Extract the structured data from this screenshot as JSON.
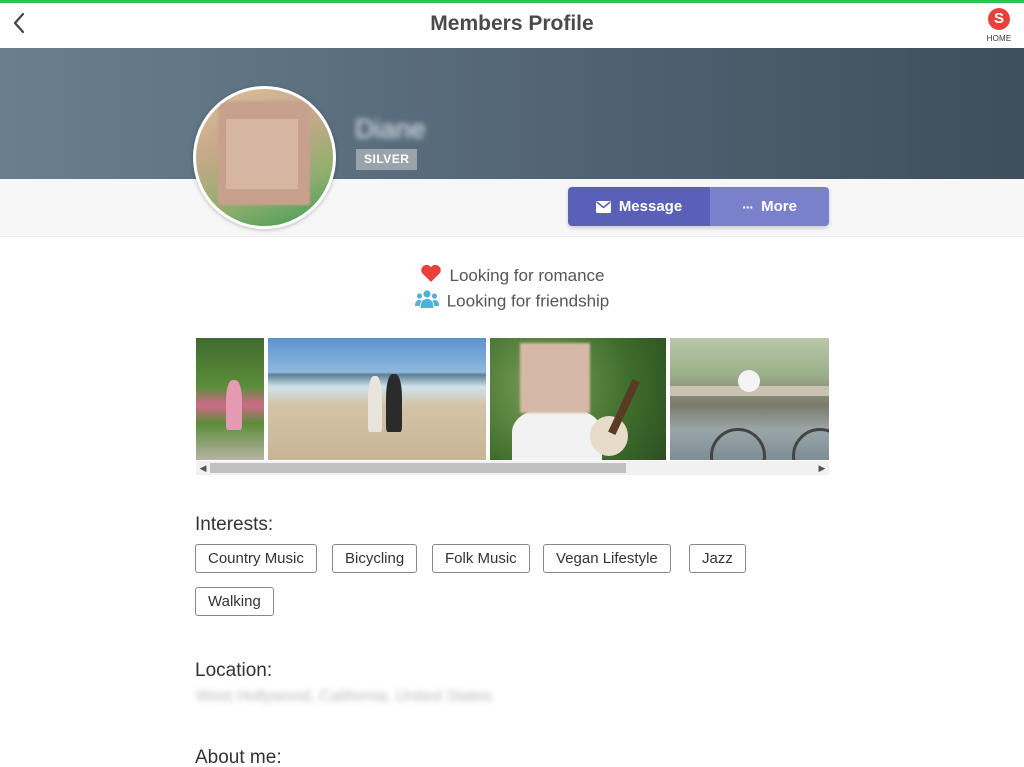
{
  "header": {
    "title": "Members Profile",
    "home_label": "HOME",
    "home_logo_letter": "S"
  },
  "profile": {
    "name": "Diane",
    "membership_badge": "SILVER",
    "actions": {
      "message_label": "Message",
      "more_label": "More",
      "more_icon": "···"
    }
  },
  "looking_for": [
    {
      "icon": "heart-icon",
      "text": "Looking for romance",
      "color": "#e8413b"
    },
    {
      "icon": "people-icon",
      "text": "Looking for friendship",
      "color": "#4fb3d9"
    }
  ],
  "gallery": {
    "photos": [
      "photo-garden",
      "photo-beach",
      "photo-guitar",
      "photo-bicycle"
    ]
  },
  "interests": {
    "title": "Interests:",
    "items": [
      "Country Music",
      "Bicycling",
      "Folk Music",
      "Vegan Lifestyle",
      "Jazz",
      "Walking"
    ]
  },
  "location": {
    "title": "Location:",
    "value": "West Hollywood, California, United States"
  },
  "about": {
    "title": "About me:"
  },
  "colors": {
    "accent_green": "#2bc44a",
    "message_button": "#5a60b8",
    "more_button": "#7b80cc",
    "badge": "#9aa3aa"
  }
}
